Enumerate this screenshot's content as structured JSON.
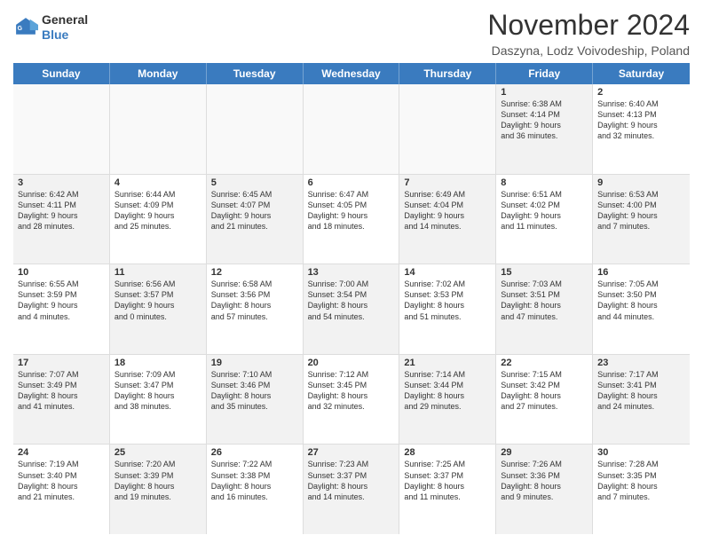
{
  "logo": {
    "general": "General",
    "blue": "Blue"
  },
  "title": "November 2024",
  "subtitle": "Daszyna, Lodz Voivodeship, Poland",
  "days_of_week": [
    "Sunday",
    "Monday",
    "Tuesday",
    "Wednesday",
    "Thursday",
    "Friday",
    "Saturday"
  ],
  "rows": [
    [
      {
        "day": "",
        "info": "",
        "empty": true
      },
      {
        "day": "",
        "info": "",
        "empty": true
      },
      {
        "day": "",
        "info": "",
        "empty": true
      },
      {
        "day": "",
        "info": "",
        "empty": true
      },
      {
        "day": "",
        "info": "",
        "empty": true
      },
      {
        "day": "1",
        "info": "Sunrise: 6:38 AM\nSunset: 4:14 PM\nDaylight: 9 hours\nand 36 minutes.",
        "shaded": true
      },
      {
        "day": "2",
        "info": "Sunrise: 6:40 AM\nSunset: 4:13 PM\nDaylight: 9 hours\nand 32 minutes.",
        "shaded": false
      }
    ],
    [
      {
        "day": "3",
        "info": "Sunrise: 6:42 AM\nSunset: 4:11 PM\nDaylight: 9 hours\nand 28 minutes.",
        "shaded": true
      },
      {
        "day": "4",
        "info": "Sunrise: 6:44 AM\nSunset: 4:09 PM\nDaylight: 9 hours\nand 25 minutes.",
        "shaded": false
      },
      {
        "day": "5",
        "info": "Sunrise: 6:45 AM\nSunset: 4:07 PM\nDaylight: 9 hours\nand 21 minutes.",
        "shaded": true
      },
      {
        "day": "6",
        "info": "Sunrise: 6:47 AM\nSunset: 4:05 PM\nDaylight: 9 hours\nand 18 minutes.",
        "shaded": false
      },
      {
        "day": "7",
        "info": "Sunrise: 6:49 AM\nSunset: 4:04 PM\nDaylight: 9 hours\nand 14 minutes.",
        "shaded": true
      },
      {
        "day": "8",
        "info": "Sunrise: 6:51 AM\nSunset: 4:02 PM\nDaylight: 9 hours\nand 11 minutes.",
        "shaded": false
      },
      {
        "day": "9",
        "info": "Sunrise: 6:53 AM\nSunset: 4:00 PM\nDaylight: 9 hours\nand 7 minutes.",
        "shaded": true
      }
    ],
    [
      {
        "day": "10",
        "info": "Sunrise: 6:55 AM\nSunset: 3:59 PM\nDaylight: 9 hours\nand 4 minutes.",
        "shaded": false
      },
      {
        "day": "11",
        "info": "Sunrise: 6:56 AM\nSunset: 3:57 PM\nDaylight: 9 hours\nand 0 minutes.",
        "shaded": true
      },
      {
        "day": "12",
        "info": "Sunrise: 6:58 AM\nSunset: 3:56 PM\nDaylight: 8 hours\nand 57 minutes.",
        "shaded": false
      },
      {
        "day": "13",
        "info": "Sunrise: 7:00 AM\nSunset: 3:54 PM\nDaylight: 8 hours\nand 54 minutes.",
        "shaded": true
      },
      {
        "day": "14",
        "info": "Sunrise: 7:02 AM\nSunset: 3:53 PM\nDaylight: 8 hours\nand 51 minutes.",
        "shaded": false
      },
      {
        "day": "15",
        "info": "Sunrise: 7:03 AM\nSunset: 3:51 PM\nDaylight: 8 hours\nand 47 minutes.",
        "shaded": true
      },
      {
        "day": "16",
        "info": "Sunrise: 7:05 AM\nSunset: 3:50 PM\nDaylight: 8 hours\nand 44 minutes.",
        "shaded": false
      }
    ],
    [
      {
        "day": "17",
        "info": "Sunrise: 7:07 AM\nSunset: 3:49 PM\nDaylight: 8 hours\nand 41 minutes.",
        "shaded": true
      },
      {
        "day": "18",
        "info": "Sunrise: 7:09 AM\nSunset: 3:47 PM\nDaylight: 8 hours\nand 38 minutes.",
        "shaded": false
      },
      {
        "day": "19",
        "info": "Sunrise: 7:10 AM\nSunset: 3:46 PM\nDaylight: 8 hours\nand 35 minutes.",
        "shaded": true
      },
      {
        "day": "20",
        "info": "Sunrise: 7:12 AM\nSunset: 3:45 PM\nDaylight: 8 hours\nand 32 minutes.",
        "shaded": false
      },
      {
        "day": "21",
        "info": "Sunrise: 7:14 AM\nSunset: 3:44 PM\nDaylight: 8 hours\nand 29 minutes.",
        "shaded": true
      },
      {
        "day": "22",
        "info": "Sunrise: 7:15 AM\nSunset: 3:42 PM\nDaylight: 8 hours\nand 27 minutes.",
        "shaded": false
      },
      {
        "day": "23",
        "info": "Sunrise: 7:17 AM\nSunset: 3:41 PM\nDaylight: 8 hours\nand 24 minutes.",
        "shaded": true
      }
    ],
    [
      {
        "day": "24",
        "info": "Sunrise: 7:19 AM\nSunset: 3:40 PM\nDaylight: 8 hours\nand 21 minutes.",
        "shaded": false
      },
      {
        "day": "25",
        "info": "Sunrise: 7:20 AM\nSunset: 3:39 PM\nDaylight: 8 hours\nand 19 minutes.",
        "shaded": true
      },
      {
        "day": "26",
        "info": "Sunrise: 7:22 AM\nSunset: 3:38 PM\nDaylight: 8 hours\nand 16 minutes.",
        "shaded": false
      },
      {
        "day": "27",
        "info": "Sunrise: 7:23 AM\nSunset: 3:37 PM\nDaylight: 8 hours\nand 14 minutes.",
        "shaded": true
      },
      {
        "day": "28",
        "info": "Sunrise: 7:25 AM\nSunset: 3:37 PM\nDaylight: 8 hours\nand 11 minutes.",
        "shaded": false
      },
      {
        "day": "29",
        "info": "Sunrise: 7:26 AM\nSunset: 3:36 PM\nDaylight: 8 hours\nand 9 minutes.",
        "shaded": true
      },
      {
        "day": "30",
        "info": "Sunrise: 7:28 AM\nSunset: 3:35 PM\nDaylight: 8 hours\nand 7 minutes.",
        "shaded": false
      }
    ]
  ]
}
